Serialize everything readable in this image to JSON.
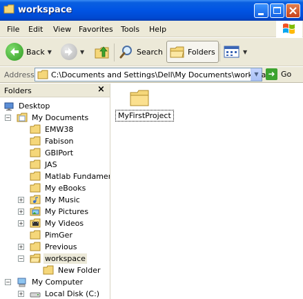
{
  "window": {
    "title": "workspace",
    "icon": "folder-icon"
  },
  "menu": {
    "items": [
      "File",
      "Edit",
      "View",
      "Favorites",
      "Tools",
      "Help"
    ]
  },
  "toolbar": {
    "back_label": "Back",
    "search_label": "Search",
    "folders_label": "Folders"
  },
  "address": {
    "label": "Address",
    "path": "C:\\Documents and Settings\\Dell\\My Documents\\workspace",
    "go_label": "Go"
  },
  "folders_pane": {
    "title": "Folders",
    "close_glyph": "×",
    "tree": [
      {
        "label": "Desktop",
        "icon": "desktop-icon",
        "expander": ""
      },
      {
        "label": "My Documents",
        "icon": "my-documents-icon",
        "expander": "−"
      },
      {
        "label": "EMW38",
        "icon": "folder-icon",
        "expander": ""
      },
      {
        "label": "Fabison",
        "icon": "folder-icon",
        "expander": ""
      },
      {
        "label": "GBIPort",
        "icon": "folder-icon",
        "expander": ""
      },
      {
        "label": "JAS",
        "icon": "folder-icon",
        "expander": ""
      },
      {
        "label": "Matlab Fundamental",
        "icon": "folder-icon",
        "expander": ""
      },
      {
        "label": "My eBooks",
        "icon": "folder-icon",
        "expander": ""
      },
      {
        "label": "My Music",
        "icon": "music-folder-icon",
        "expander": "+"
      },
      {
        "label": "My Pictures",
        "icon": "pictures-folder-icon",
        "expander": "+"
      },
      {
        "label": "My Videos",
        "icon": "videos-folder-icon",
        "expander": "+"
      },
      {
        "label": "PimGer",
        "icon": "folder-icon",
        "expander": ""
      },
      {
        "label": "Previous",
        "icon": "folder-icon",
        "expander": "+"
      },
      {
        "label": "workspace",
        "icon": "open-folder-icon",
        "expander": "−",
        "selected": true
      },
      {
        "label": "New Folder",
        "icon": "folder-icon",
        "expander": ""
      },
      {
        "label": "My Computer",
        "icon": "my-computer-icon",
        "expander": "−"
      },
      {
        "label": "Local Disk (C:)",
        "icon": "local-disk-icon",
        "expander": "+"
      }
    ]
  },
  "content": {
    "items": [
      {
        "label": "MyFirstProject",
        "icon": "folder-icon"
      }
    ]
  },
  "colors": {
    "titlebar": "#0054e3",
    "chrome": "#ece9d8",
    "folder": "#f5d77a",
    "go_green": "#3ca32f"
  }
}
